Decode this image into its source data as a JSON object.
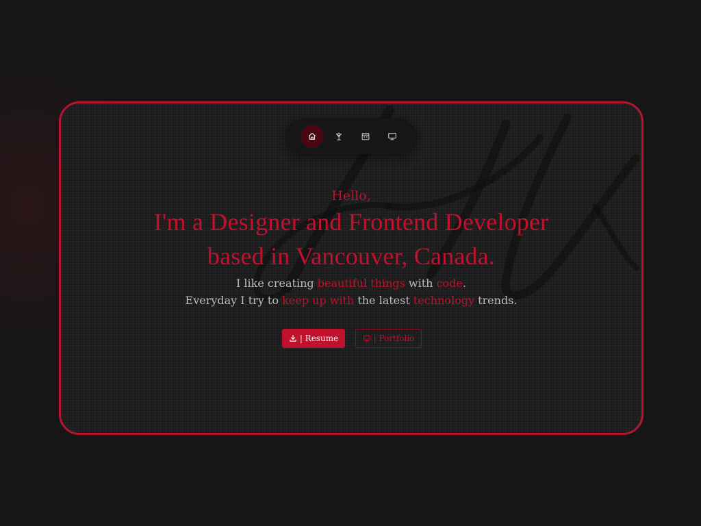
{
  "nav": {
    "items": [
      {
        "icon": "home-icon",
        "active": true
      },
      {
        "icon": "skills-icon",
        "active": false
      },
      {
        "icon": "calendar-icon",
        "active": false
      },
      {
        "icon": "monitor-icon",
        "active": false
      }
    ]
  },
  "hero": {
    "greeting": "Hello,",
    "headline_line1": "I'm a Designer and Frontend Developer",
    "headline_line2": "based in Vancouver, Canada.",
    "line1": {
      "a": "I like creating ",
      "hl1": "beautiful things",
      "b": " with ",
      "hl2": "code",
      "c": "."
    },
    "line2": {
      "a": "Everyday I try to ",
      "hl1": "keep up with",
      "b": " the latest ",
      "hl2": "technology",
      "c": " trends."
    }
  },
  "actions": {
    "resume_label": "| Resume",
    "portfolio_label": "| Portfolio"
  },
  "colors": {
    "accent": "#c0122d",
    "background": "#171617",
    "card": "#1d1d1e",
    "text": "#bdbdbd"
  }
}
